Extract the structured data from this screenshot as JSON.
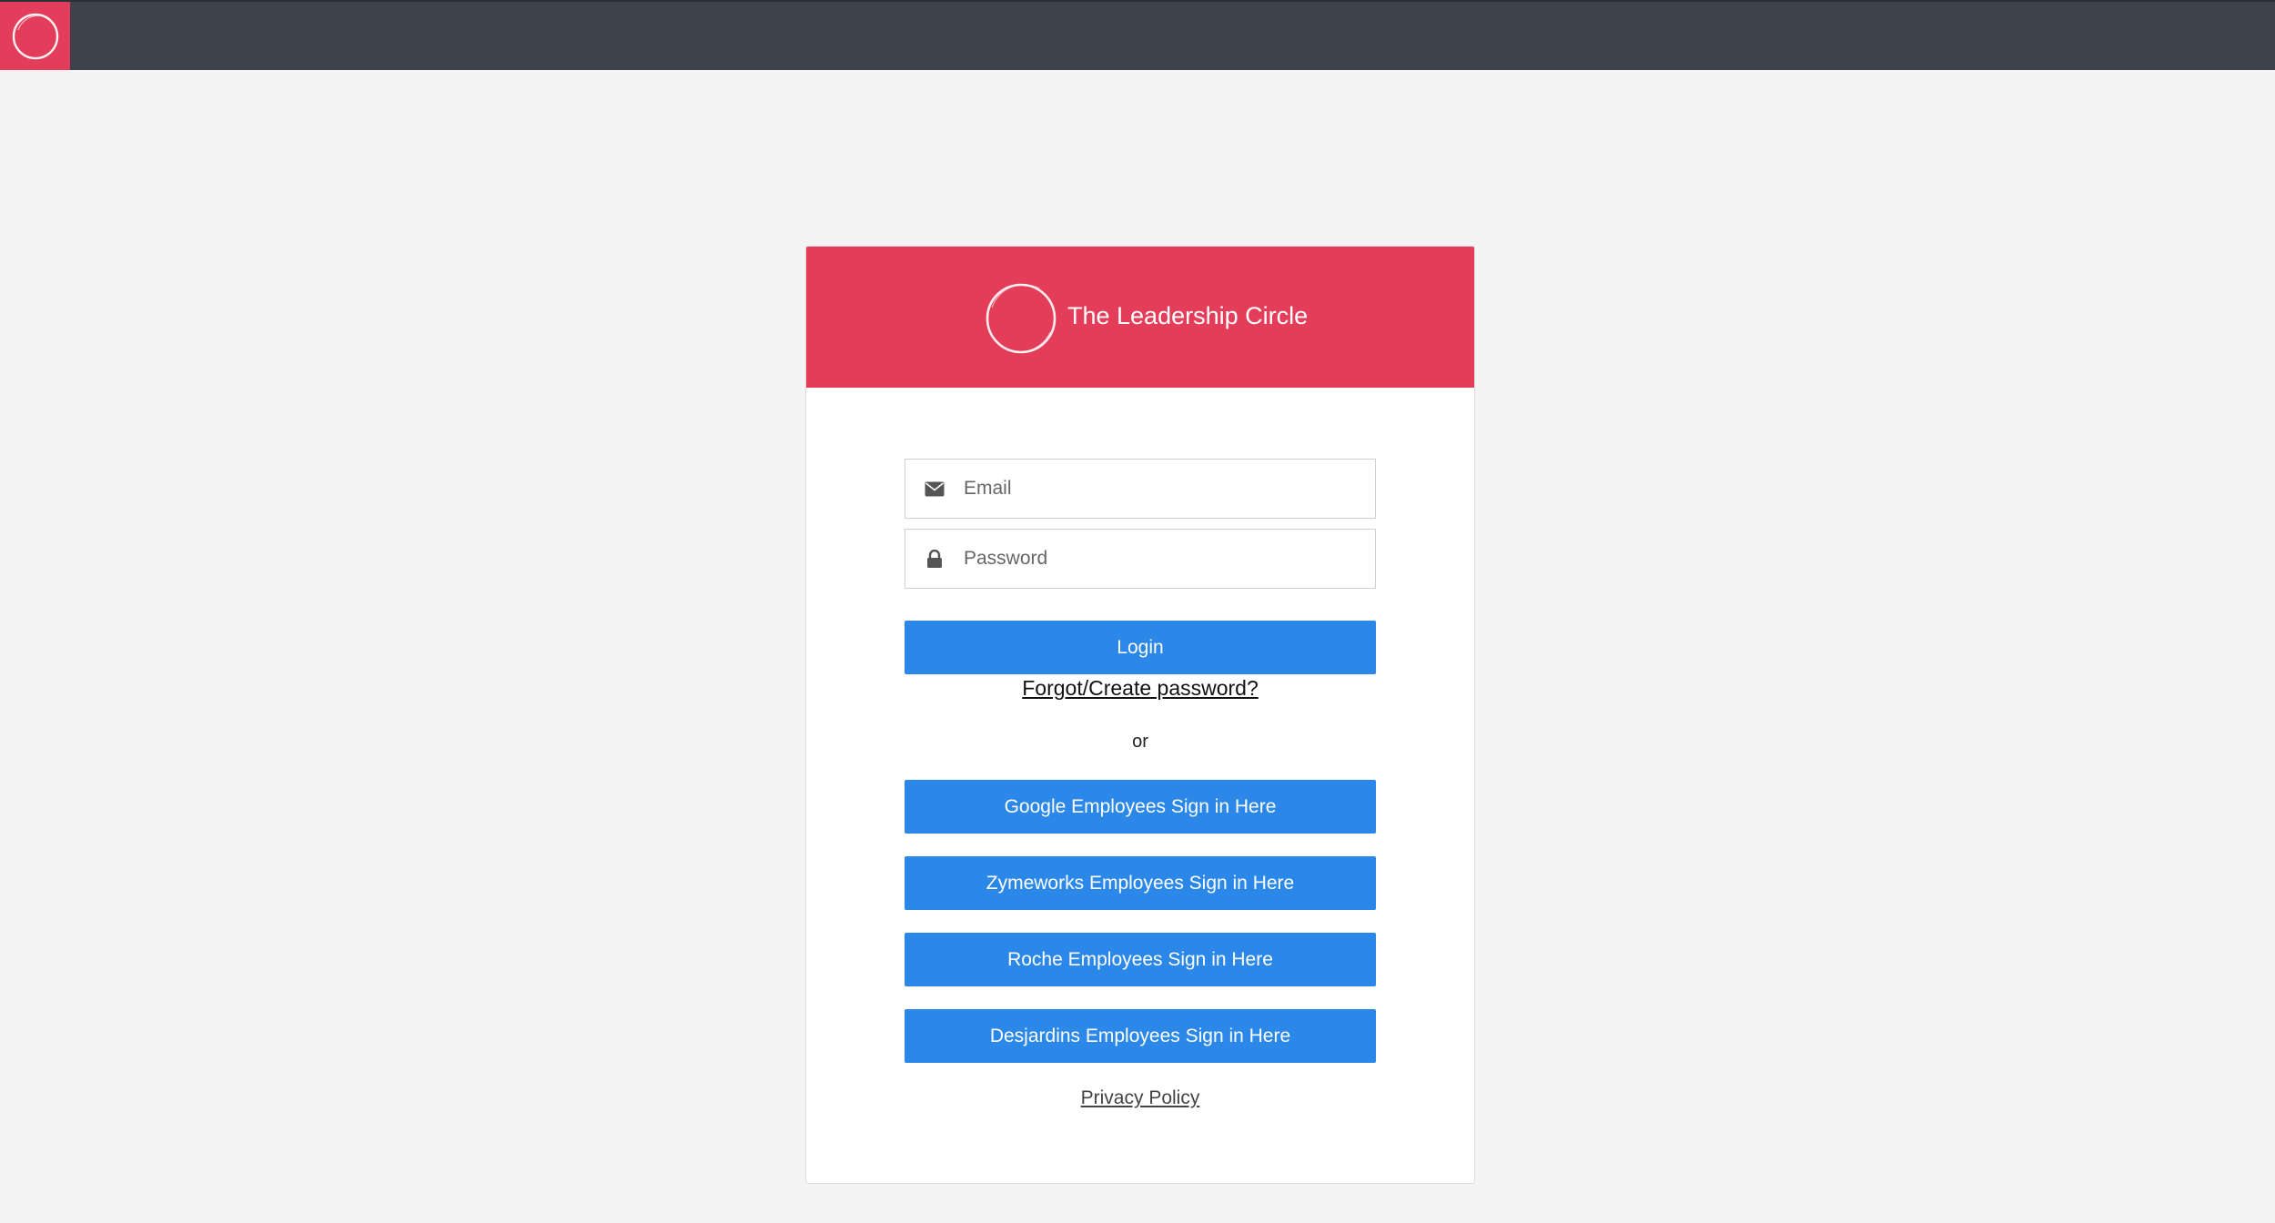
{
  "app": {
    "brand_name": "The Leadership Circle",
    "brand_color": "#e43d5a",
    "topbar_color": "#3c434c",
    "button_color": "#2b88e8"
  },
  "login": {
    "email_placeholder": "Email",
    "email_icon": "envelope-icon",
    "password_placeholder": "Password",
    "password_icon": "lock-icon",
    "login_label": "Login",
    "forgot_label": "Forgot/Create password?",
    "or_label": "or",
    "sso_buttons": [
      {
        "label": "Google Employees Sign in Here"
      },
      {
        "label": "Zymeworks Employees Sign in Here"
      },
      {
        "label": "Roche Employees Sign in Here"
      },
      {
        "label": "Desjardins Employees Sign in Here"
      }
    ],
    "privacy_label": "Privacy Policy"
  }
}
